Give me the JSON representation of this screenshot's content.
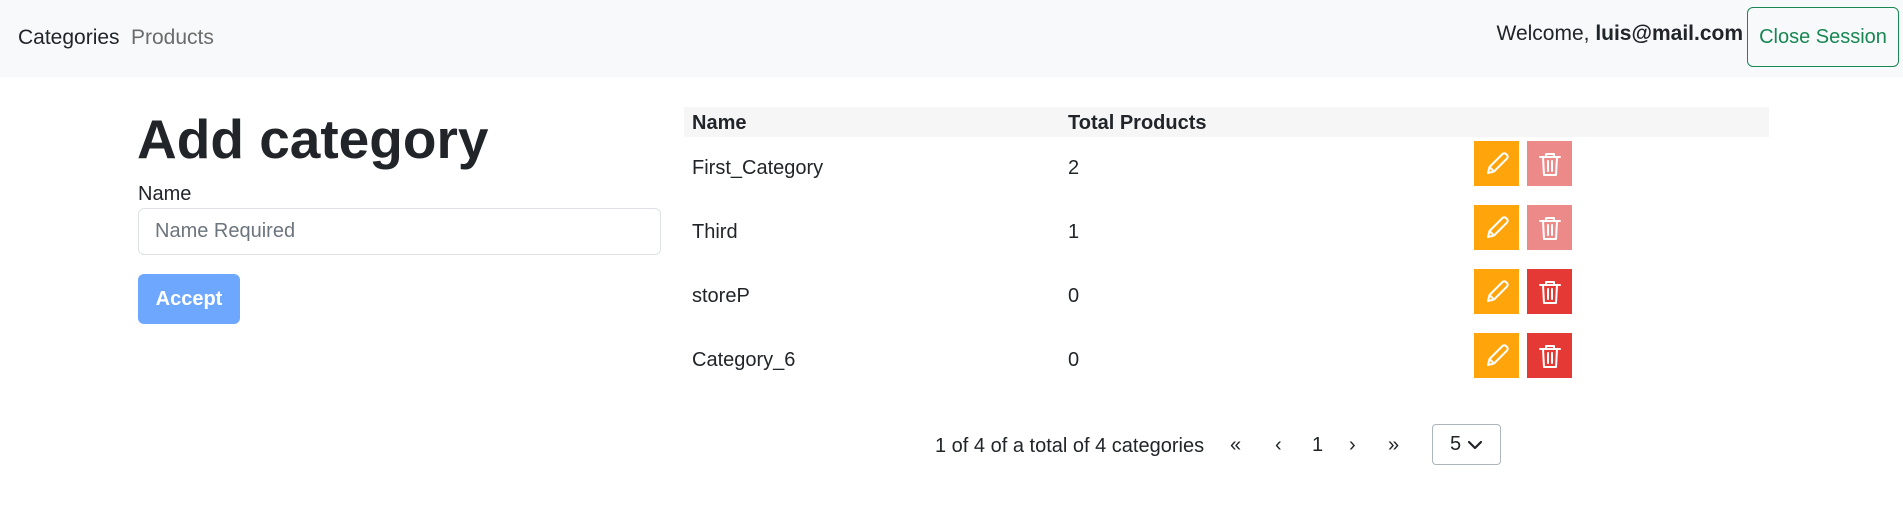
{
  "nav": {
    "items": [
      {
        "label": "Categories"
      },
      {
        "label": "Products"
      }
    ],
    "welcome_prefix": "Welcome, ",
    "user_email": "luis@mail.com",
    "close_session": "Close Session"
  },
  "form": {
    "title": "Add category",
    "name_label": "Name",
    "name_placeholder": "Name Required",
    "name_value": "",
    "accept_label": "Accept"
  },
  "table": {
    "headers": {
      "name": "Name",
      "total": "Total Products"
    },
    "rows": [
      {
        "name": "First_Category",
        "total": "2",
        "delete_enabled": false
      },
      {
        "name": "Third",
        "total": "1",
        "delete_enabled": false
      },
      {
        "name": "storeP",
        "total": "0",
        "delete_enabled": true
      },
      {
        "name": "Category_6",
        "total": "0",
        "delete_enabled": true
      }
    ]
  },
  "pagination": {
    "summary": "1 of 4 of a total of 4 categories",
    "first": "«",
    "prev": "‹",
    "current_page": "1",
    "next": "›",
    "last": "»",
    "page_size": "5"
  },
  "colors": {
    "edit": "#ffa40a",
    "delete": "#e53935",
    "delete_disabled": "#ec8a8a",
    "accept": "#6ea8fe",
    "close_session": "#198754"
  },
  "icons": {
    "edit": "pencil-icon",
    "delete": "trash-icon",
    "page_size_toggle": "chevron-down-icon"
  }
}
